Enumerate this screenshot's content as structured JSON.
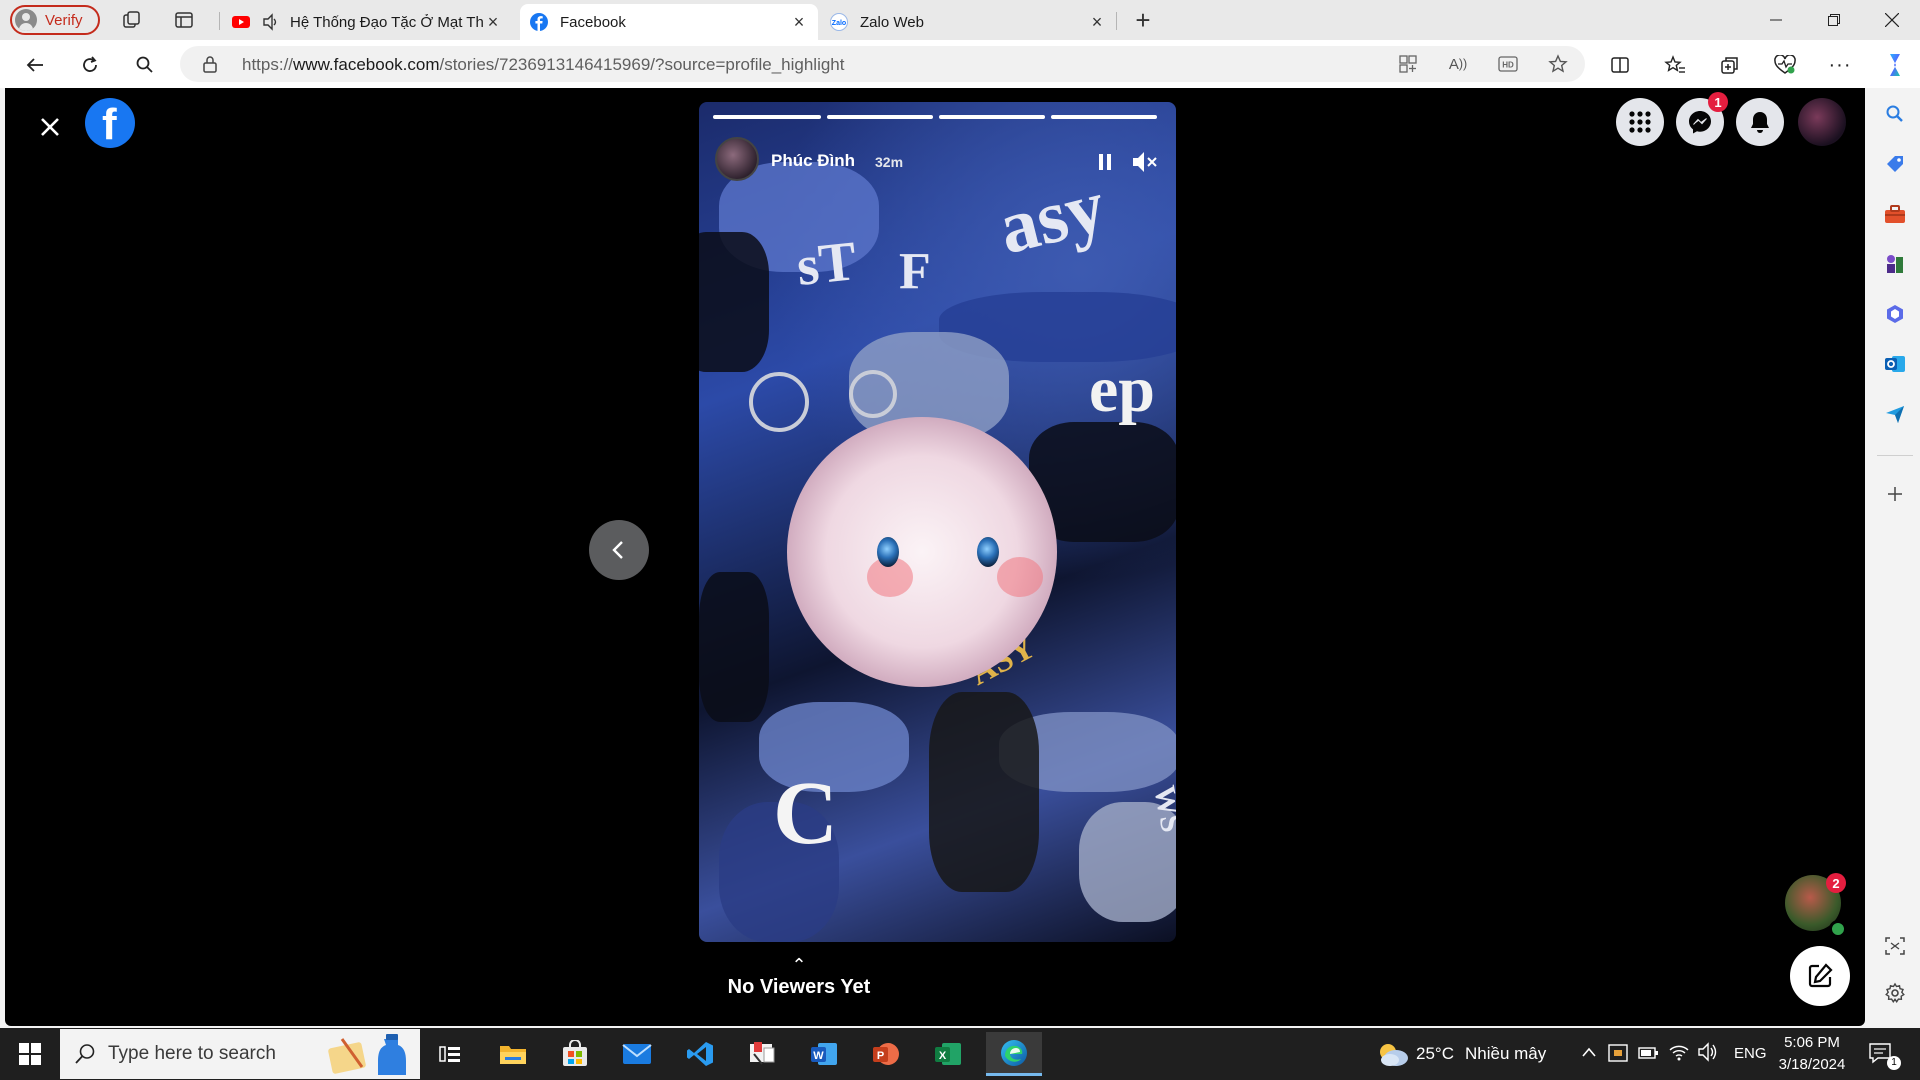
{
  "browser": {
    "profile_label": "Verify",
    "tabs": [
      {
        "title": "Hệ Thống Đạo Tặc Ở Mạt Th",
        "favicon": "youtube-icon",
        "audio": "speaker-icon"
      },
      {
        "title": "Facebook",
        "favicon": "facebook-icon",
        "active": true
      },
      {
        "title": "Zalo Web",
        "favicon": "zalo-icon"
      }
    ],
    "new_tab": "+",
    "url_prefix": "https://",
    "url_host": "www.facebook.com",
    "url_path": "/stories/7236913146415969/?source=profile_highlight"
  },
  "facebook": {
    "logo_letter": "f",
    "messenger_badge": "1",
    "story": {
      "author": "Phúc Đình",
      "time": "32m",
      "segments": 4,
      "sticker_text": [
        "sT",
        "F",
        "asy",
        "ep",
        "C",
        "ASY",
        "WS"
      ]
    },
    "viewers_label": "No Viewers Yet",
    "viewers_chevron": "⌃",
    "contact_badge": "2"
  },
  "taskbar": {
    "search_placeholder": "Type here to search",
    "weather_temp": "25°C",
    "weather_desc": "Nhiều mây",
    "language": "ENG",
    "time": "5:06 PM",
    "date": "3/18/2024",
    "notification_count": "1",
    "apps": [
      "task-view-icon",
      "file-explorer-icon",
      "microsoft-store-icon",
      "mail-icon",
      "vscode-icon",
      "snipping-tool-icon",
      "word-icon",
      "powerpoint-icon",
      "excel-icon",
      "edge-icon"
    ]
  },
  "colors": {
    "facebook_blue": "#1877f2",
    "badge_red": "#e41e3f",
    "online_green": "#31a24c",
    "edge_accent": "#76b9ed"
  }
}
